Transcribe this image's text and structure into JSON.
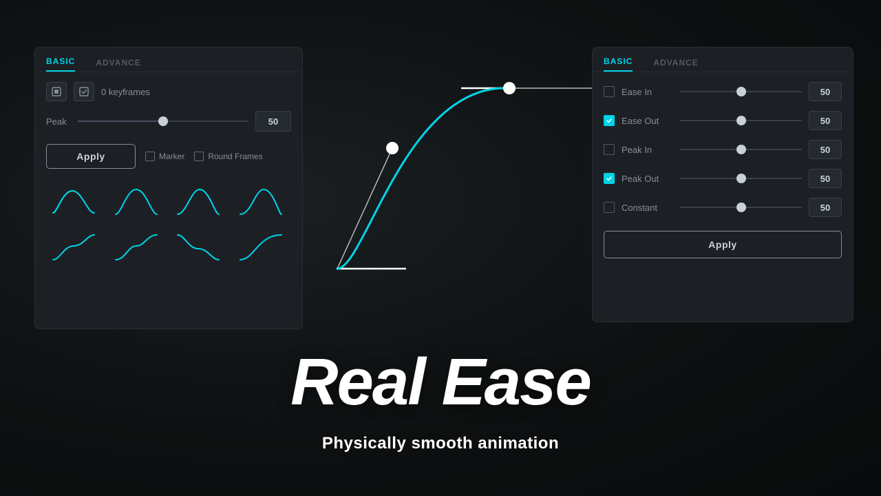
{
  "background": {
    "color": "#111213"
  },
  "left_panel": {
    "tabs": [
      {
        "id": "basic",
        "label": "BASIC",
        "active": true
      },
      {
        "id": "advance",
        "label": "ADVANCE",
        "active": false
      }
    ],
    "keyframes_label": "0 keyframes",
    "peak_label": "Peak",
    "peak_value": "50",
    "apply_label": "Apply",
    "marker_label": "Marker",
    "round_frames_label": "Round Frames",
    "curves": [
      {
        "id": "curve-1"
      },
      {
        "id": "curve-2"
      },
      {
        "id": "curve-3"
      },
      {
        "id": "curve-4"
      },
      {
        "id": "curve-5"
      },
      {
        "id": "curve-6"
      },
      {
        "id": "curve-7"
      },
      {
        "id": "curve-8"
      }
    ]
  },
  "right_panel": {
    "tabs": [
      {
        "id": "basic",
        "label": "BASIC",
        "active": true
      },
      {
        "id": "advance",
        "label": "ADVANCE",
        "active": false
      }
    ],
    "params": [
      {
        "label": "Ease In",
        "value": "50",
        "checked": false
      },
      {
        "label": "Ease Out",
        "value": "50",
        "checked": true
      },
      {
        "label": "Peak In",
        "value": "50",
        "checked": false
      },
      {
        "label": "Peak Out",
        "value": "50",
        "checked": true
      },
      {
        "label": "Constant",
        "value": "50",
        "checked": false
      }
    ],
    "apply_label": "Apply"
  },
  "title": "Real Ease",
  "subtitle": "Physically smooth animation"
}
